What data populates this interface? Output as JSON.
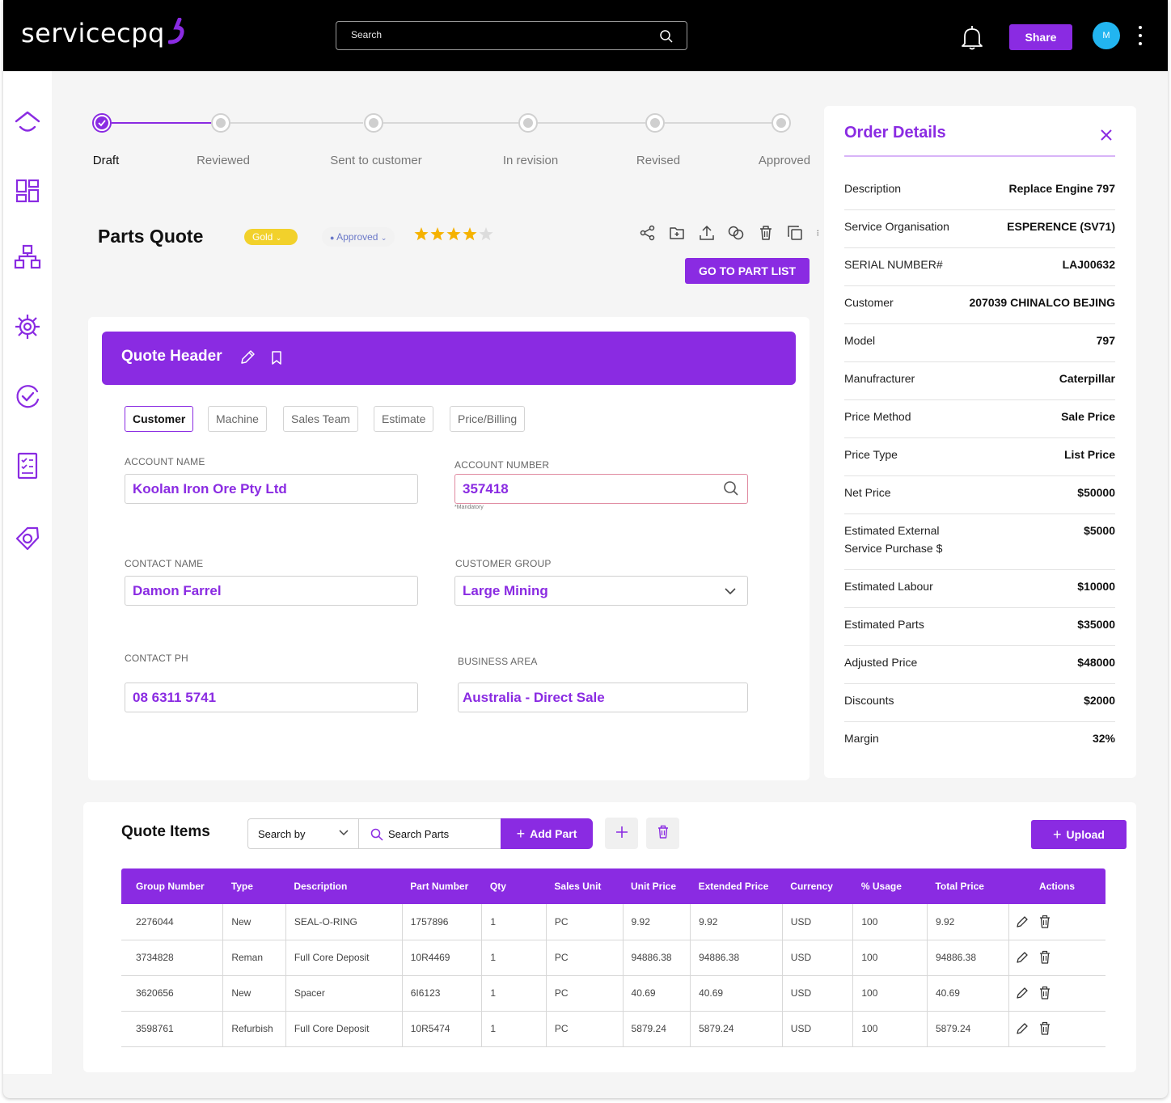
{
  "header": {
    "logo": "servicecpq",
    "search_placeholder": "Search",
    "share_label": "Share",
    "avatar_initial": "M"
  },
  "sidebar": {
    "items": [
      "home-icon",
      "dashboard-icon",
      "hierarchy-icon",
      "settings-icon",
      "approval-icon",
      "checklist-icon",
      "tag-icon"
    ]
  },
  "stepper": {
    "steps": [
      {
        "label": "Draft",
        "state": "complete"
      },
      {
        "label": "Reviewed",
        "state": "pending"
      },
      {
        "label": "Sent to customer",
        "state": "pending"
      },
      {
        "label": "In revision",
        "state": "pending"
      },
      {
        "label": "Revised",
        "state": "pending"
      },
      {
        "label": "Approved",
        "state": "pending"
      }
    ]
  },
  "quote": {
    "title": "Parts Quote",
    "tier_badge": "Gold",
    "status": "Approved",
    "rating": 4,
    "rating_max": 5,
    "go_to_part_list": "GO TO PART LIST",
    "toolbar_icons": [
      "share-icon",
      "new-folder-icon",
      "upload-icon",
      "link-icon",
      "trash-icon",
      "copy-icon",
      "more-icon"
    ]
  },
  "quote_header": {
    "title": "Quote Header",
    "tabs": [
      "Customer",
      "Machine",
      "Sales Team",
      "Estimate",
      "Price/Billing"
    ],
    "active_tab": "Customer",
    "fields": {
      "account_name": {
        "label": "ACCOUNT NAME",
        "value": "Koolan Iron Ore Pty Ltd"
      },
      "account_number": {
        "label": "ACCOUNT NUMBER",
        "value": "357418",
        "note": "*Mandatory"
      },
      "contact_name": {
        "label": "CONTACT NAME",
        "value": "Damon Farrel"
      },
      "customer_group": {
        "label": "CUSTOMER GROUP",
        "value": "Large Mining"
      },
      "contact_ph": {
        "label": "CONTACT PH",
        "value": "08 6311 5741"
      },
      "business_area": {
        "label": "BUSINESS AREA",
        "value": "Australia - Direct Sale"
      }
    }
  },
  "order_details": {
    "title": "Order Details",
    "rows": [
      {
        "label": "Description",
        "value": "Replace Engine 797"
      },
      {
        "label": "Service Organisation",
        "value": "ESPERENCE (SV71)"
      },
      {
        "label": "SERIAL NUMBER#",
        "value": "LAJ00632"
      },
      {
        "label": "Customer",
        "value": "207039 CHINALCO BEJING"
      },
      {
        "label": "Model",
        "value": "797"
      },
      {
        "label": "Manufracturer",
        "value": "Caterpillar"
      },
      {
        "label": "Price Method",
        "value": "Sale Price"
      },
      {
        "label": "Price Type",
        "value": "List Price"
      },
      {
        "label": "Net Price",
        "value": "$50000"
      },
      {
        "label": "Estimated External",
        "label2": "Service Purchase $",
        "value": "$5000"
      },
      {
        "label": "Estimated Labour",
        "value": "$10000"
      },
      {
        "label": "Estimated Parts",
        "value": "$35000"
      },
      {
        "label": "Adjusted Price",
        "value": "$48000"
      },
      {
        "label": "Discounts",
        "value": "$2000"
      },
      {
        "label": "Margin",
        "value": "32%"
      }
    ]
  },
  "quote_items": {
    "title": "Quote Items",
    "search_by": "Search by",
    "search_placeholder": "Search Parts",
    "add_part": "Add Part",
    "upload": "Upload",
    "columns": [
      "Group Number",
      "Type",
      "Description",
      "Part Number",
      "Qty",
      "Sales Unit",
      "Unit Price",
      "Extended Price",
      "Currency",
      "% Usage",
      "Total Price",
      "Actions"
    ],
    "rows": [
      [
        "2276044",
        "New",
        "SEAL-O-RING",
        "1757896",
        "1",
        "PC",
        "9.92",
        "9.92",
        "USD",
        "100",
        "9.92"
      ],
      [
        "3734828",
        "Reman",
        "Full Core Deposit",
        "10R4469",
        "1",
        "PC",
        "94886.38",
        "94886.38",
        "USD",
        "100",
        "94886.38"
      ],
      [
        "3620656",
        "New",
        "Spacer",
        "6I6123",
        "1",
        "PC",
        "40.69",
        "40.69",
        "USD",
        "100",
        "40.69"
      ],
      [
        "3598761",
        "Refurbish",
        "Full Core Deposit",
        "10R5474",
        "1",
        "PC",
        "5879.24",
        "5879.24",
        "USD",
        "100",
        "5879.24"
      ]
    ]
  },
  "colors": {
    "accent": "#8a2be2",
    "gold": "#f2d12b",
    "star": "#f5b200",
    "avatar": "#22b5f0"
  }
}
